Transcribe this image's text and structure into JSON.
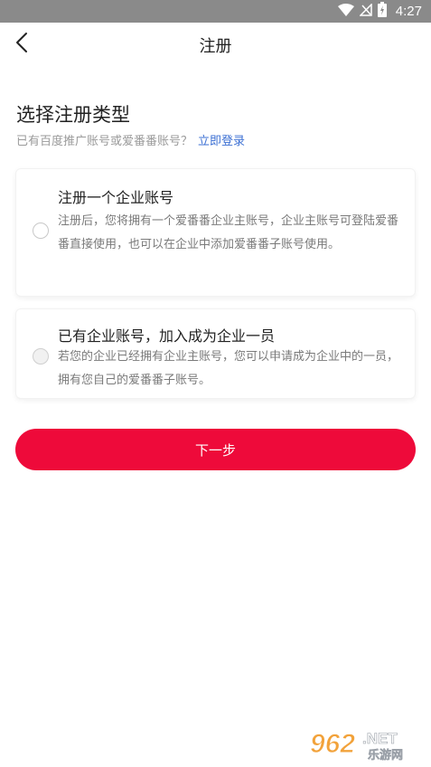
{
  "status_bar": {
    "time": "4:27"
  },
  "nav": {
    "title": "注册"
  },
  "heading": "选择注册类型",
  "subtitle": {
    "text": "已有百度推广账号或爱番番账号？",
    "link": "立即登录"
  },
  "options": [
    {
      "title": "注册一个企业账号",
      "description": "注册后，您将拥有一个爱番番企业主账号，企业主账号可登陆爱番番直接使用，也可以在企业中添加爱番番子账号使用。",
      "selected": false
    },
    {
      "title": "已有企业账号，加入成为企业一员",
      "description": "若您的企业已经拥有企业主账号，您可以申请成为企业中的一员，拥有您自己的爱番番子账号。",
      "selected": false
    }
  ],
  "next_button": "下一步",
  "watermark": {
    "number": "962",
    "suffix": ".NET",
    "name": "乐游网"
  },
  "colors": {
    "accent": "#ee0a3a",
    "link": "#3b6fd3",
    "status_bar": "#8a8a8a"
  }
}
